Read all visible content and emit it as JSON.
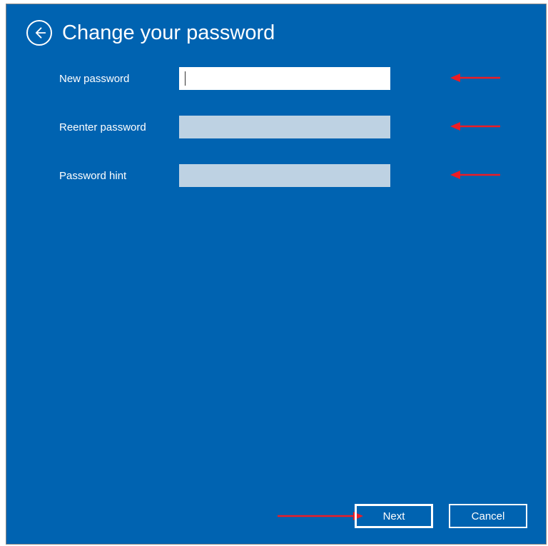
{
  "header": {
    "title": "Change your password"
  },
  "form": {
    "new_password": {
      "label": "New password",
      "value": ""
    },
    "reenter_password": {
      "label": "Reenter password",
      "value": ""
    },
    "password_hint": {
      "label": "Password hint",
      "value": ""
    }
  },
  "footer": {
    "next_label": "Next",
    "cancel_label": "Cancel"
  },
  "annotations": {
    "arrow_color": "#ed1c24"
  }
}
